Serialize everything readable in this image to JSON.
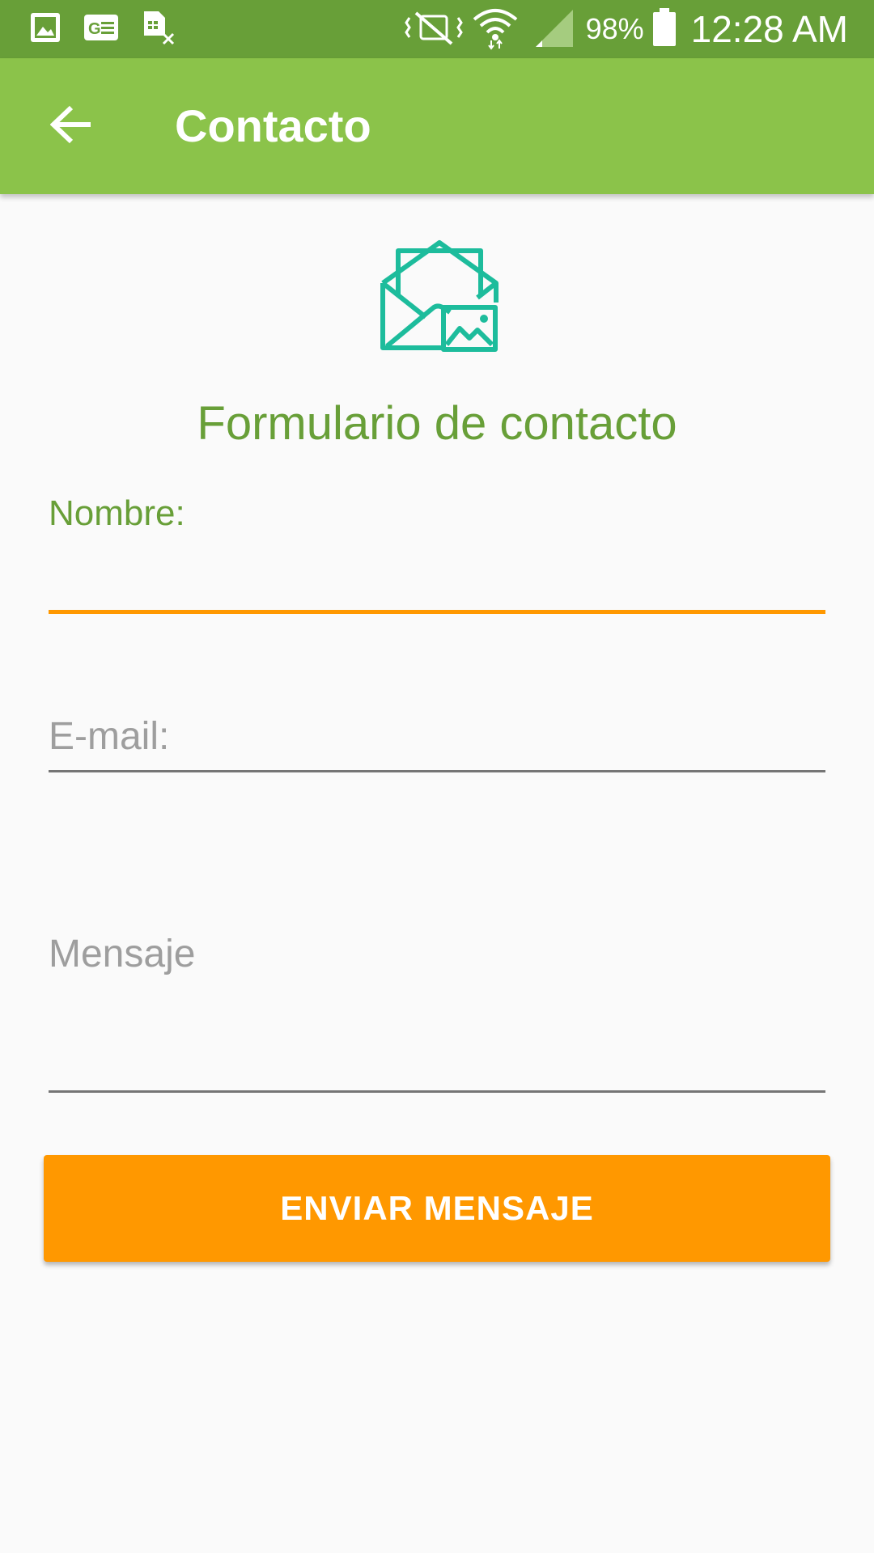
{
  "status_bar": {
    "battery_percent": "98%",
    "time": "12:28 AM",
    "icons_left": [
      "gallery-icon",
      "ge-icon",
      "sim-error-icon"
    ],
    "icons_right": [
      "vibrate-mute-icon",
      "wifi-icon",
      "signal-icon",
      "battery-icon"
    ]
  },
  "app_bar": {
    "title": "Contacto",
    "back_icon": "arrow-back-icon"
  },
  "form": {
    "icon": "envelope-image-icon",
    "title": "Formulario de contacto",
    "name_label": "Nombre:",
    "name_value": "",
    "email_placeholder": "E-mail:",
    "email_value": "",
    "message_placeholder": "Mensaje",
    "message_value": "",
    "submit_label": "ENVIAR MENSAJE"
  },
  "colors": {
    "status_bar": "#689f38",
    "app_bar": "#8bc34a",
    "accent": "#ff9800",
    "title_green": "#689f38",
    "hero_icon": "#1dbc9c"
  }
}
